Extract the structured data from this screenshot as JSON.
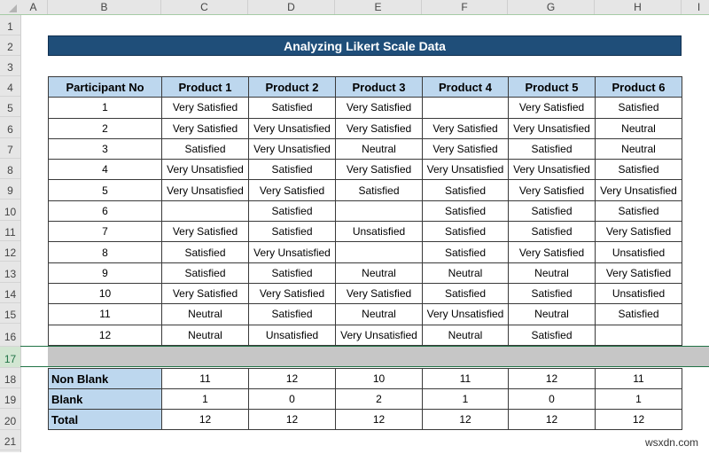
{
  "sheet": {
    "columns": [
      "A",
      "B",
      "C",
      "D",
      "E",
      "F",
      "G",
      "H",
      "I"
    ],
    "rows": [
      "1",
      "2",
      "3",
      "4",
      "5",
      "6",
      "7",
      "8",
      "9",
      "10",
      "11",
      "12",
      "13",
      "14",
      "15",
      "16",
      "17",
      "18",
      "19",
      "20",
      "21"
    ],
    "selected_row": "17"
  },
  "title": "Analyzing Likert Scale Data",
  "table": {
    "headers": [
      "Participant No",
      "Product 1",
      "Product 2",
      "Product 3",
      "Product 4",
      "Product 5",
      "Product 6"
    ],
    "rows": [
      [
        "1",
        "Very Satisfied",
        "Satisfied",
        "Very Satisfied",
        "",
        "Very Satisfied",
        "Satisfied"
      ],
      [
        "2",
        "Very Satisfied",
        "Very Unsatisfied",
        "Very Satisfied",
        "Very Satisfied",
        "Very Unsatisfied",
        "Neutral"
      ],
      [
        "3",
        "Satisfied",
        "Very Unsatisfied",
        "Neutral",
        "Very Satisfied",
        "Satisfied",
        "Neutral"
      ],
      [
        "4",
        "Very Unsatisfied",
        "Satisfied",
        "Very Satisfied",
        "Very Unsatisfied",
        "Very Unsatisfied",
        "Satisfied"
      ],
      [
        "5",
        "Very Unsatisfied",
        "Very Satisfied",
        "Satisfied",
        "Satisfied",
        "Very Satisfied",
        "Very Unsatisfied"
      ],
      [
        "6",
        "",
        "Satisfied",
        "",
        "Satisfied",
        "Satisfied",
        "Satisfied"
      ],
      [
        "7",
        "Very Satisfied",
        "Satisfied",
        "Unsatisfied",
        "Satisfied",
        "Satisfied",
        "Very Satisfied"
      ],
      [
        "8",
        "Satisfied",
        "Very Unsatisfied",
        "",
        "Satisfied",
        "Very Satisfied",
        "Unsatisfied"
      ],
      [
        "9",
        "Satisfied",
        "Satisfied",
        "Neutral",
        "Neutral",
        "Neutral",
        "Very Satisfied"
      ],
      [
        "10",
        "Very Satisfied",
        "Very Satisfied",
        "Very Satisfied",
        "Satisfied",
        "Satisfied",
        "Unsatisfied"
      ],
      [
        "11",
        "Neutral",
        "Satisfied",
        "Neutral",
        "Very Unsatisfied",
        "Neutral",
        "Satisfied"
      ],
      [
        "12",
        "Neutral",
        "Unsatisfied",
        "Very Unsatisfied",
        "Neutral",
        "Satisfied",
        ""
      ]
    ]
  },
  "summary": [
    {
      "label": "Non Blank",
      "values": [
        "11",
        "12",
        "10",
        "11",
        "12",
        "11"
      ]
    },
    {
      "label": "Blank",
      "values": [
        "1",
        "0",
        "2",
        "1",
        "0",
        "1"
      ]
    },
    {
      "label": "Total",
      "values": [
        "12",
        "12",
        "12",
        "12",
        "12",
        "12"
      ]
    }
  ],
  "colors": {
    "title_bg": "#1f4e79",
    "header_bg": "#bdd7ee",
    "selection": "#217346"
  },
  "watermark": "wsxdn.com"
}
